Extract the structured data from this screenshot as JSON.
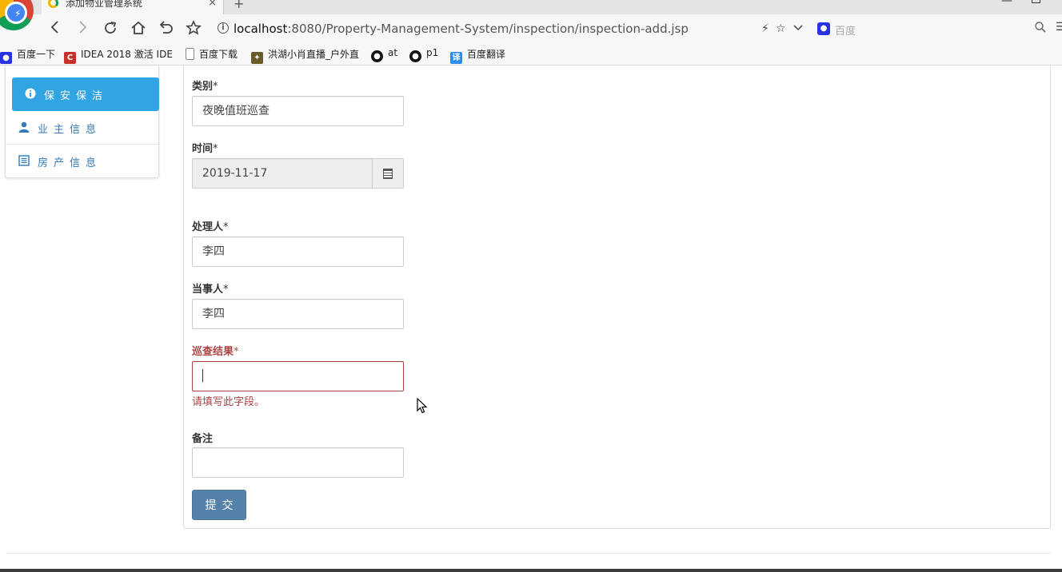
{
  "browser": {
    "tab_title": "添加物业管理系统",
    "tab_close": "×",
    "new_tab": "+",
    "url_host": "localhost",
    "url_rest": ":8080/Property-Management-System/inspection/inspection-add.jsp",
    "search_placeholder": "百度",
    "bookmarks": [
      {
        "label": "百度一下",
        "icon": "baidu-paw-icon",
        "color": "#2932e1"
      },
      {
        "label": "IDEA 2018 激活 IDE",
        "icon": "csdn-c-icon",
        "color": "#c9302c"
      },
      {
        "label": "百度下载",
        "icon": "document-icon",
        "color": "#888888"
      },
      {
        "label": "洪湖小肖直播_户外直",
        "icon": "bee-icon",
        "color": "#6b5b2b"
      },
      {
        "label": "at",
        "icon": "github-icon",
        "color": "#111111"
      },
      {
        "label": "p1",
        "icon": "github-icon",
        "color": "#111111"
      },
      {
        "label": "百度翻译",
        "icon": "translate-icon",
        "color": "#2d8cf0"
      }
    ]
  },
  "sidebar": {
    "items": [
      {
        "label": "保安保洁",
        "icon": "info-circle-icon",
        "active": true
      },
      {
        "label": "业主信息",
        "icon": "user-icon",
        "active": false
      },
      {
        "label": "房产信息",
        "icon": "list-icon",
        "active": false
      }
    ]
  },
  "form": {
    "category": {
      "label": "类别",
      "required": "*",
      "value": "夜晚值班巡查"
    },
    "time": {
      "label": "时间",
      "required": "*",
      "value": "2019-11-17"
    },
    "handler": {
      "label": "处理人",
      "required": "*",
      "value": "李四"
    },
    "party": {
      "label": "当事人",
      "required": "*",
      "value": "李四"
    },
    "result": {
      "label": "巡查结果",
      "required": "*",
      "value": "",
      "error": "请填写此字段。"
    },
    "remark": {
      "label": "备注",
      "value": ""
    },
    "submit_label": "提交"
  },
  "colors": {
    "active_nav": "#31a5e3",
    "link": "#337ab7",
    "error": "#a94442",
    "submit": "#5582ab"
  }
}
